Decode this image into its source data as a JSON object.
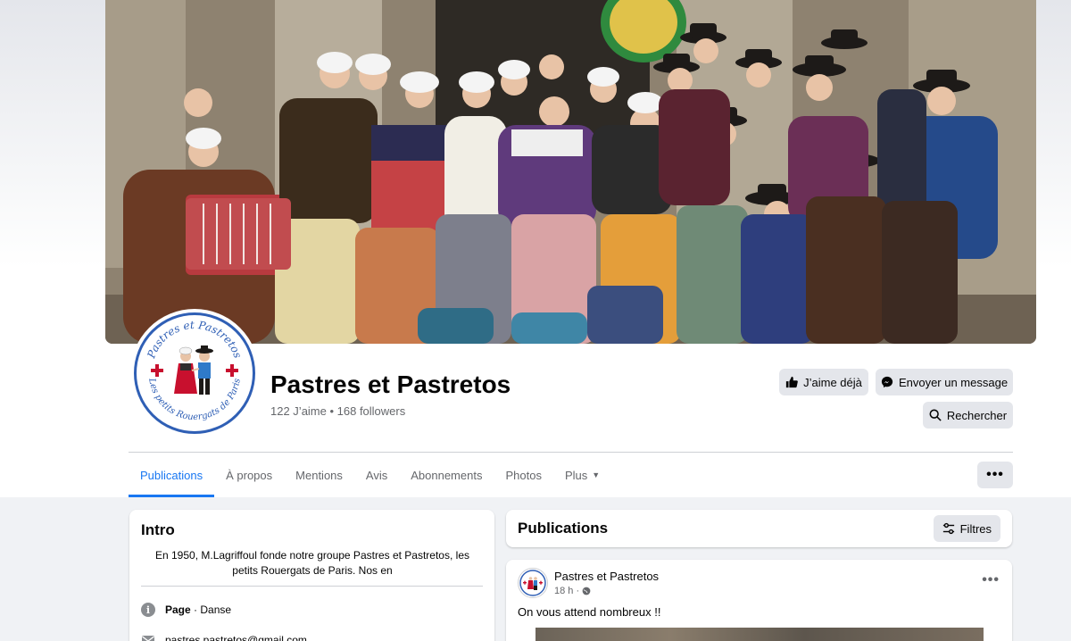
{
  "page": {
    "name": "Pastres et Pastretos",
    "stats": "122 J’aime • 168 followers"
  },
  "actions": {
    "like_label": "J’aime déjà",
    "message_label": "Envoyer un message",
    "search_label": "Rechercher"
  },
  "tabs": [
    {
      "label": "Publications",
      "active": true
    },
    {
      "label": "À propos"
    },
    {
      "label": "Mentions"
    },
    {
      "label": "Avis"
    },
    {
      "label": "Abonnements"
    },
    {
      "label": "Photos"
    },
    {
      "label": "Plus"
    }
  ],
  "more_label": "•••",
  "intro": {
    "title": "Intro",
    "bio": "En 1950, M.Lagriffoul fonde notre groupe Pastres et Pastretos, les petits Rouergats de Paris. Nos en",
    "category_label": "Page",
    "category_value": " · Danse",
    "email": "pastres.pastretos@gmail.com"
  },
  "publications": {
    "title": "Publications",
    "filter_label": "Filtres"
  },
  "post": {
    "author": "Pastres et Pastretos",
    "time": "18 h ·",
    "text": "On vous attend nombreux !!",
    "menu": "•••"
  },
  "logo": {
    "top_text": "Pastres et Pastretos",
    "bottom_text": "Les petits Rouergats de Paris"
  },
  "colors": {
    "accent": "#1877f2",
    "button_bg": "#e4e6eb",
    "logo_blue": "#2f5fb5",
    "logo_red": "#c8102e"
  },
  "icons": {
    "like": "thumbs-up-icon",
    "message": "messenger-icon",
    "search": "search-icon",
    "filter": "sliders-icon",
    "info": "info-icon",
    "email": "mail-icon",
    "globe": "globe-icon"
  }
}
